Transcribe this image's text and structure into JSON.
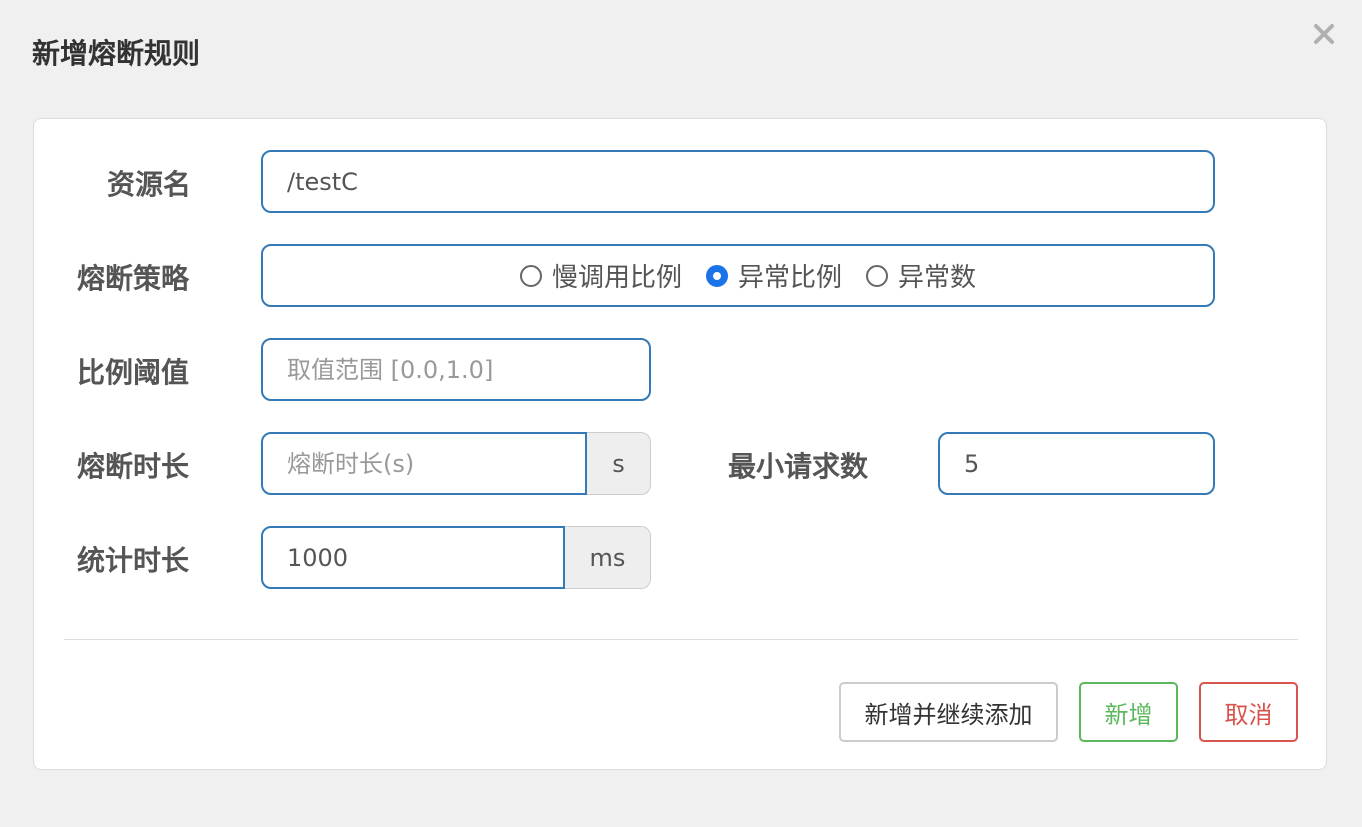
{
  "dialog": {
    "title": "新增熔断规则",
    "close_icon": "close-icon"
  },
  "form": {
    "resource": {
      "label": "资源名",
      "value": "/testC"
    },
    "strategy": {
      "label": "熔断策略",
      "options": [
        "慢调用比例",
        "异常比例",
        "异常数"
      ],
      "selected": "异常比例"
    },
    "ratio_threshold": {
      "label": "比例阈值",
      "value": "",
      "placeholder": "取值范围 [0.0,1.0]"
    },
    "break_duration": {
      "label": "熔断时长",
      "value": "",
      "placeholder": "熔断时长(s)",
      "unit": "s"
    },
    "min_requests": {
      "label": "最小请求数",
      "value": "5"
    },
    "stat_duration": {
      "label": "统计时长",
      "value": "1000",
      "unit": "ms"
    }
  },
  "buttons": {
    "add_continue": "新增并继续添加",
    "add": "新增",
    "cancel": "取消"
  },
  "colors": {
    "input_border": "#337ab7",
    "radio_checked": "#1a73e8",
    "success": "#5cb85c",
    "danger": "#d9534f"
  }
}
